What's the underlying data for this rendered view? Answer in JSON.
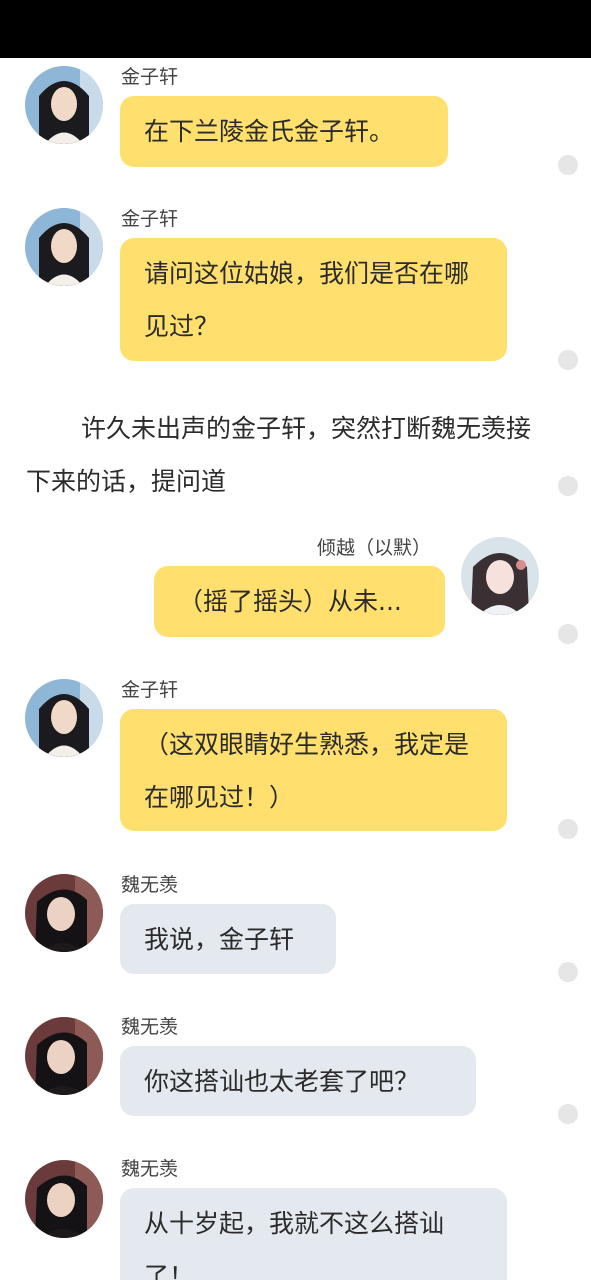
{
  "colors": {
    "accent_bubble": "#ffdf6e",
    "other_bubble": "#e4e9ef"
  },
  "messages": [
    {
      "speaker": "金子轩",
      "text": "在下兰陵金氏金子轩。"
    },
    {
      "speaker": "金子轩",
      "text": "请问这位姑娘，我们是否在哪见过？"
    },
    {
      "speaker": "倾越（以默）",
      "text": "（摇了摇头）从未..."
    },
    {
      "speaker": "金子轩",
      "text": "（这双眼睛好生熟悉，我定是在哪见过！）"
    },
    {
      "speaker": "魏无羡",
      "text": "我说，金子轩"
    },
    {
      "speaker": "魏无羡",
      "text": "你这搭讪也太老套了吧？"
    },
    {
      "speaker": "魏无羡",
      "text": "从十岁起，我就不这么搭讪了！"
    }
  ],
  "narration": "许久未出声的金子轩，突然打断魏无羡接下来的话，提问道",
  "avatars": {
    "jin": "male-long-hair-avatar",
    "qingyue": "female-hairpin-avatar",
    "wei": "male-dark-hair-avatar"
  }
}
